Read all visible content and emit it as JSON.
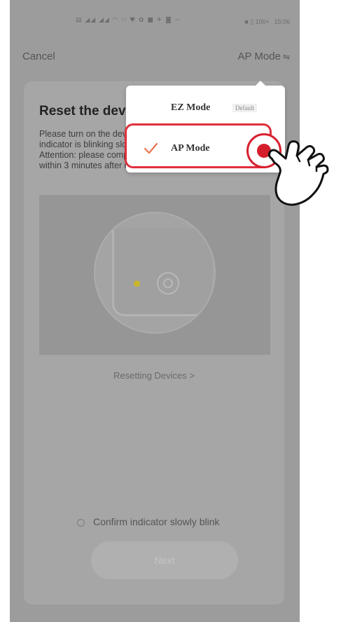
{
  "status_bar": {
    "time": "15:06",
    "battery": "■ ▯ 100+",
    "icons": [
      "signal-icon",
      "wifi-icon",
      "notification-icon"
    ]
  },
  "header": {
    "cancel_label": "Cancel",
    "mode_label": "AP Mode",
    "mode_icon": "swap-icon"
  },
  "card": {
    "title": "Reset the device",
    "instructions": [
      "Please turn on the device and confirm the",
      "indicator is blinking slowly.",
      "Attention: please complete the network pairing",
      "within 3 minutes after device reset."
    ],
    "resetting_link": "Resetting Devices >",
    "confirm_label": "Confirm indicator slowly blink",
    "next_label": "Next"
  },
  "mode_menu": {
    "items": [
      {
        "label": "EZ Mode",
        "tag": "Default",
        "selected": false
      },
      {
        "label": "AP Mode",
        "tag": "",
        "selected": true
      }
    ]
  },
  "colors": {
    "highlight": "#e0303d",
    "check": "#e8744f"
  }
}
